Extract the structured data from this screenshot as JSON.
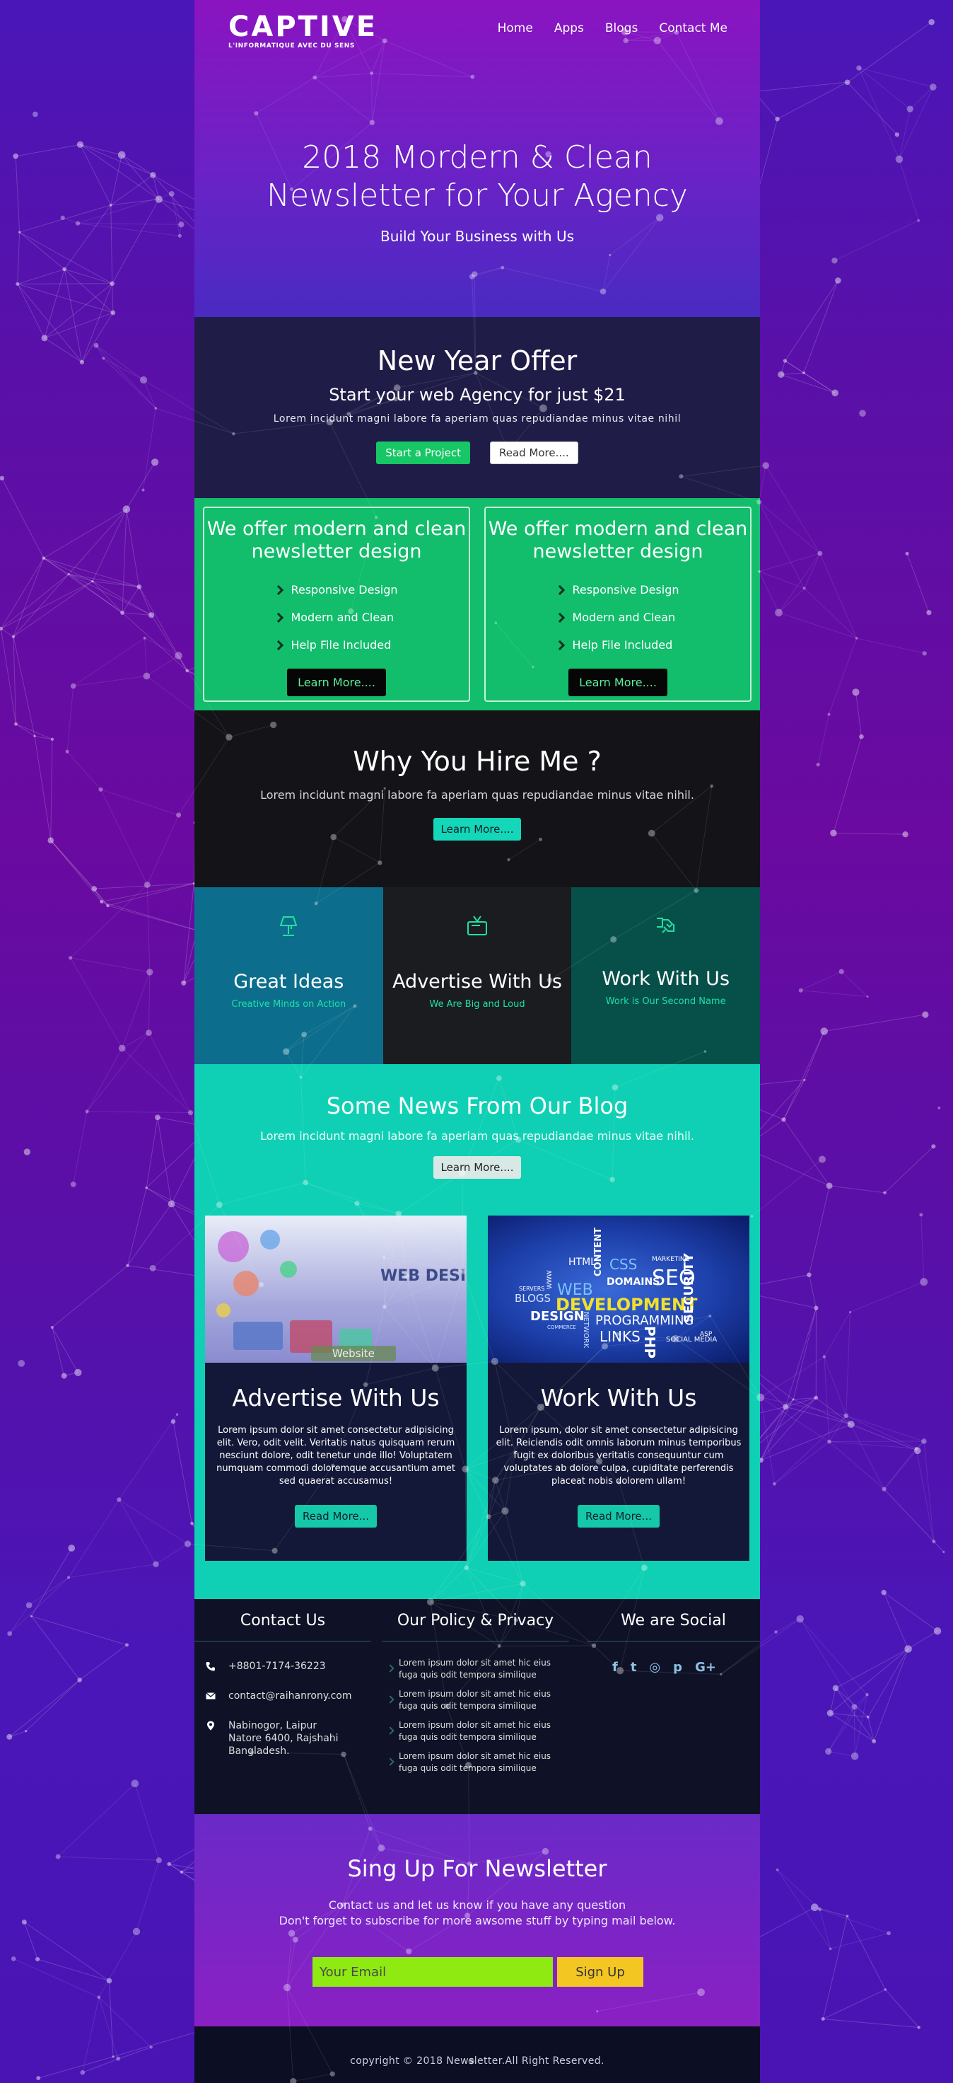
{
  "brand": {
    "logo": "CAPTIVE",
    "tagline": "L'INFORMATIQUE AVEC DU SENS"
  },
  "nav": [
    "Home",
    "Apps",
    "Blogs",
    "Contact Me"
  ],
  "hero": {
    "title_line1": "2018 Mordern & Clean",
    "title_line2": "Newsletter for Your Agency",
    "subtitle": "Build Your Business with Us"
  },
  "offer": {
    "title": "New Year Offer",
    "subtitle": "Start your web Agency for just $21",
    "text": "Lorem incidunt magni labore fa aperiam quas repudiandae minus vitae nihil",
    "btn_primary": "Start a Project",
    "btn_secondary": "Read More...."
  },
  "features": [
    {
      "title_line1": "We offer modern and clean",
      "title_line2": "newsletter design",
      "items": [
        "Responsive Design",
        "Modern and Clean",
        "Help File Included"
      ],
      "button": "Learn More...."
    },
    {
      "title_line1": "We offer modern and clean",
      "title_line2": "newsletter design",
      "items": [
        "Responsive Design",
        "Modern and Clean",
        "Help File Included"
      ],
      "button": "Learn More...."
    }
  ],
  "why": {
    "title": "Why You Hire Me ?",
    "text": "Lorem incidunt magni labore fa aperiam quas repudiandae minus vitae nihil.",
    "button": "Learn More...."
  },
  "services": [
    {
      "icon": "lamp-icon",
      "title": "Great Ideas",
      "subtitle": "Creative Minds on Action"
    },
    {
      "icon": "tv-icon",
      "title": "Advertise With Us",
      "subtitle": "We Are Big and Loud"
    },
    {
      "icon": "handshake-icon",
      "title": "Work With Us",
      "subtitle": "Work is Our Second Name"
    }
  ],
  "blog": {
    "title": "Some News From Our Blog",
    "text": "Lorem incidunt magni labore fa aperiam quas repudiandae minus vitae nihil.",
    "button": "Learn More....",
    "posts": [
      {
        "image_label": "WEB DESIGNING",
        "image_badge": "Website",
        "title": "Advertise With Us",
        "text": "Lorem ipsum dolor sit amet consectetur adipisicing elit. Vero, odit velit. Veritatis natus quisquam rerum nesciunt dolore, odit tenetur unde illo! Voluptatem numquam commodi doloremque accusantium amet sed quaerat accusamus!",
        "button": "Read More..."
      },
      {
        "image_words": [
          "WEB",
          "DEVELOPMENT",
          "HTML",
          "CSS",
          "SEO",
          "DOMAINS",
          "BLOGS",
          "DESIGN",
          "PROGRAMMING",
          "LINKS",
          "PHP",
          "SECURITY",
          "CONTENT",
          "NETWORK",
          "SOCIAL MEDIA",
          "SERVERS",
          "MARKETING",
          "ASP",
          "WWW",
          "COMMERCE"
        ],
        "title": "Work With Us",
        "text": "Lorem ipsum, dolor sit amet consectetur adipisicing elit. Reiciendis odit omnis laborum minus temporibus fugit ex doloribus veritatis consequuntur cum voluptates ab dolore culpa, cupiditate perferendis placeat nobis dolorem ullam!",
        "button": "Read More..."
      }
    ]
  },
  "footer": {
    "contact_title": "Contact Us",
    "phone": "+8801-7174-36223",
    "email": "contact@raihanrony.com",
    "address": "Nabinogor, Laipur Natore 6400, Rajshahi Bangladesh.",
    "policy_title": "Our Policy & Privacy",
    "policy_items": [
      "Lorem ipsum dolor sit amet hic eius fuga quis odit tempora similique",
      "Lorem ipsum dolor sit amet hic eius fuga quis odit tempora similique",
      "Lorem ipsum dolor sit amet hic eius fuga quis odit tempora similique",
      "Lorem ipsum dolor sit amet hic eius fuga quis odit tempora similique"
    ],
    "social_title": "We are Social",
    "social_icons": [
      "facebook-icon",
      "twitter-icon",
      "instagram-icon",
      "pinterest-icon",
      "google-plus-icon"
    ],
    "social_glyphs": [
      "f",
      "t",
      "◎",
      "p",
      "G+"
    ]
  },
  "newsletter": {
    "title": "Sing Up For Newsletter",
    "line1": "Contact us and let us know if you have any question",
    "line2": "Don't forget to subscribe for more awsome stuff by typing mail below.",
    "placeholder": "Your Email",
    "button": "Sign Up"
  },
  "copyright": "copyright © 2018 Newsletter.All Right Reserved.",
  "colors": {
    "accent_green": "#17c664",
    "accent_cyan": "#0fd0b4",
    "input_lime": "#8eea10",
    "signup_yellow": "#f4c622"
  }
}
